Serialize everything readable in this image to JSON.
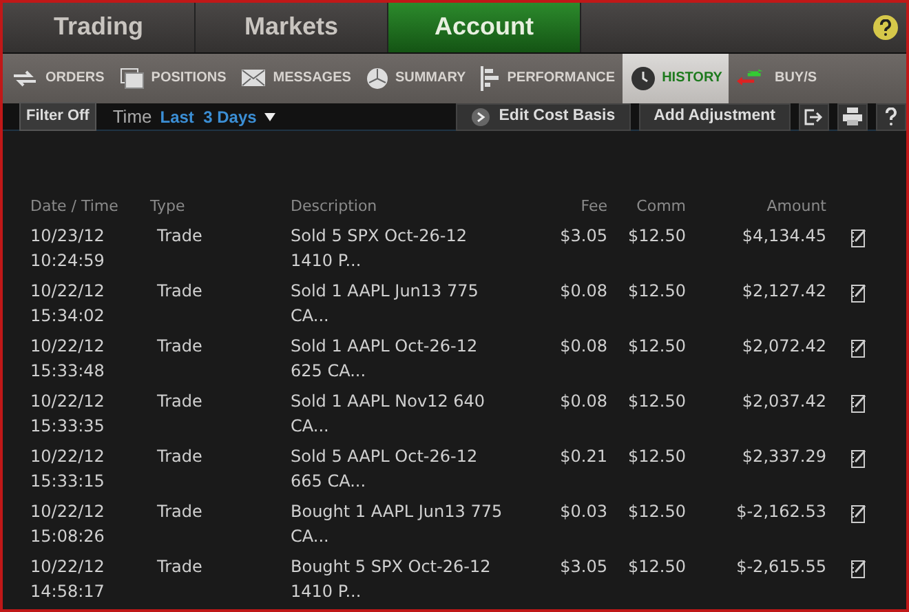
{
  "top_tabs": [
    {
      "label": "Trading",
      "selected": false
    },
    {
      "label": "Markets",
      "selected": false
    },
    {
      "label": "Account",
      "selected": true
    }
  ],
  "sub_tabs": [
    {
      "label": "ORDERS",
      "selected": false
    },
    {
      "label": "POSITIONS",
      "selected": false
    },
    {
      "label": "MESSAGES",
      "selected": false
    },
    {
      "label": "SUMMARY",
      "selected": false
    },
    {
      "label": "PERFORMANCE",
      "selected": false
    },
    {
      "label": "HISTORY",
      "selected": true
    },
    {
      "label": "BUY/S",
      "selected": false
    }
  ],
  "toolbar": {
    "filter_button": "Filter Off",
    "time_label": "Time",
    "time_value": "Last  3 Days",
    "edit_button": "Edit Cost Basis",
    "adjust_button": "Add Adjustment"
  },
  "table": {
    "columns": [
      "Date / Time",
      "Type",
      "Description",
      "Fee",
      "Comm",
      "Amount"
    ],
    "rows": [
      {
        "date": "10/23/12",
        "time": "10:24:59",
        "type": "Trade",
        "description": "Sold 5 SPX Oct-26-12 1410 P...",
        "fee": "$3.05",
        "comm": "$12.50",
        "amount": "$4,134.45"
      },
      {
        "date": "10/22/12",
        "time": "15:34:02",
        "type": "Trade",
        "description": "Sold 1 AAPL Jun13 775 CA...",
        "fee": "$0.08",
        "comm": "$12.50",
        "amount": "$2,127.42"
      },
      {
        "date": "10/22/12",
        "time": "15:33:48",
        "type": "Trade",
        "description": "Sold 1 AAPL Oct-26-12 625 CA...",
        "fee": "$0.08",
        "comm": "$12.50",
        "amount": "$2,072.42"
      },
      {
        "date": "10/22/12",
        "time": "15:33:35",
        "type": "Trade",
        "description": "Sold 1 AAPL Nov12 640 CA...",
        "fee": "$0.08",
        "comm": "$12.50",
        "amount": "$2,037.42"
      },
      {
        "date": "10/22/12",
        "time": "15:33:15",
        "type": "Trade",
        "description": "Sold 5 AAPL Oct-26-12 665 CA...",
        "fee": "$0.21",
        "comm": "$12.50",
        "amount": "$2,337.29"
      },
      {
        "date": "10/22/12",
        "time": "15:08:26",
        "type": "Trade",
        "description": "Bought 1 AAPL Jun13 775 CA...",
        "fee": "$0.03",
        "comm": "$12.50",
        "amount": "$-2,162.53"
      },
      {
        "date": "10/22/12",
        "time": "14:58:17",
        "type": "Trade",
        "description": "Bought 5 SPX Oct-26-12 1410 P...",
        "fee": "$3.05",
        "comm": "$12.50",
        "amount": "$-2,615.55"
      }
    ]
  }
}
